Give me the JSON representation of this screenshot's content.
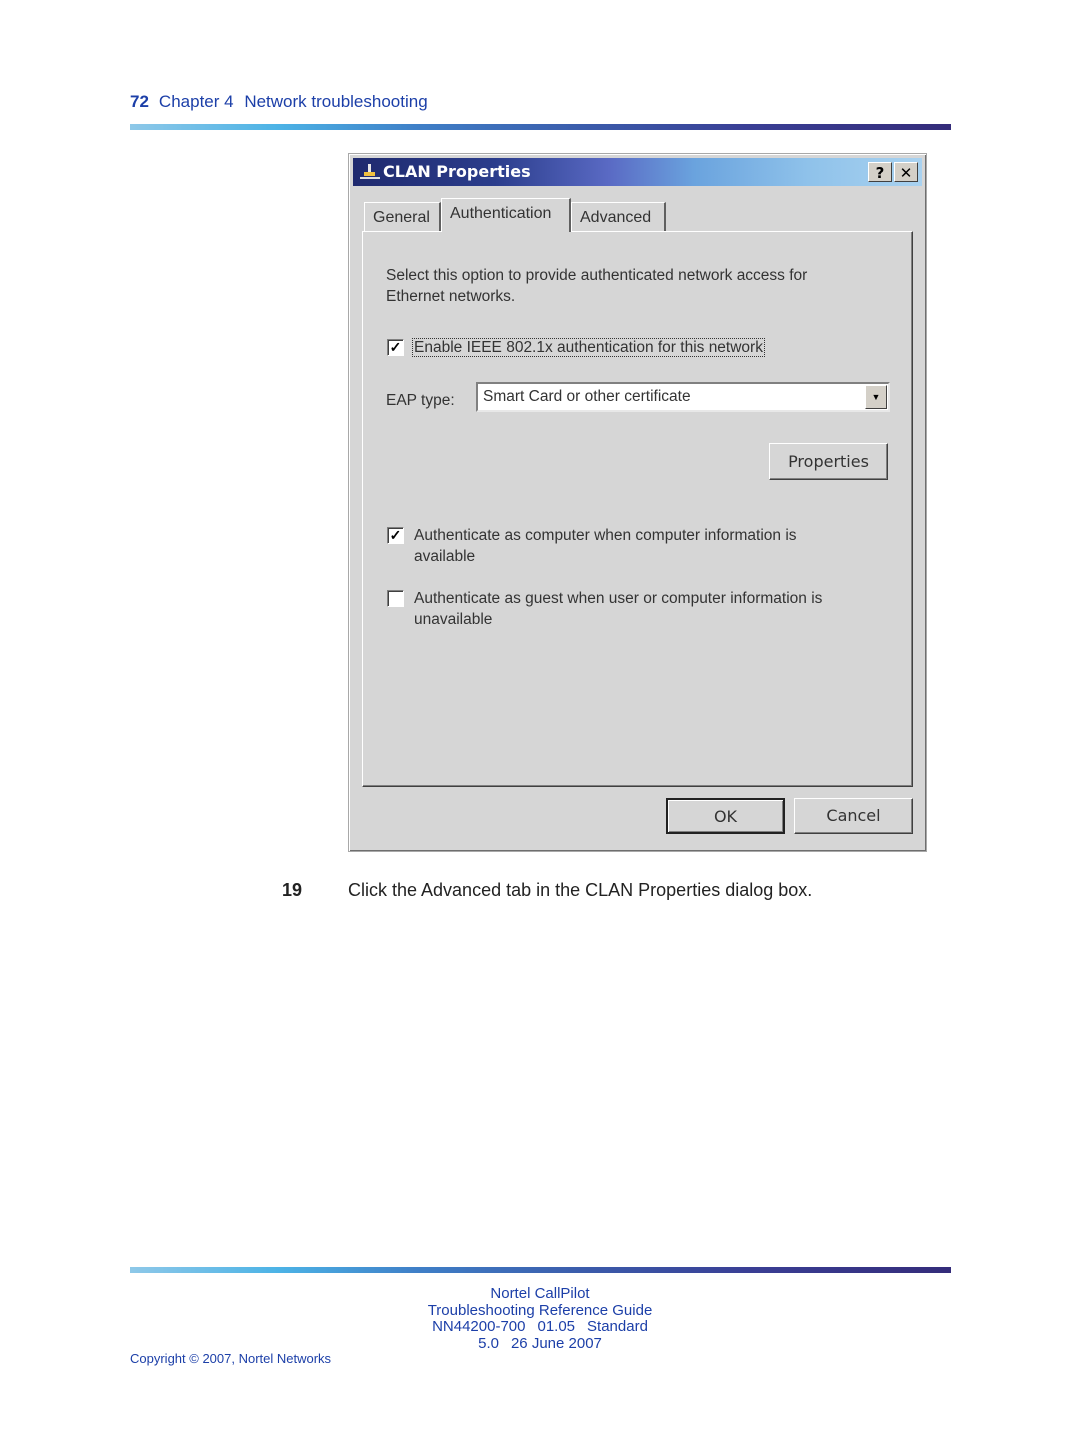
{
  "header": {
    "page_number": "72",
    "chapter": "Chapter 4",
    "section": "Network troubleshooting"
  },
  "dialog": {
    "title": "CLAN Properties",
    "title_icon": "network-connection-icon",
    "help_button": "?",
    "close_button": "✕",
    "tabs": [
      {
        "label": "General",
        "active": false
      },
      {
        "label": "Authentication",
        "active": true
      },
      {
        "label": "Advanced",
        "active": false
      }
    ],
    "description": "Select this option to provide authenticated network access for Ethernet networks.",
    "enable_8021x": {
      "label": "Enable IEEE 802.1x authentication for this network",
      "checked": true
    },
    "eap_type": {
      "label": "EAP type:",
      "value": "Smart Card or other certificate"
    },
    "properties_button": "Properties",
    "auth_computer": {
      "label": "Authenticate as computer when computer information is available",
      "checked": true
    },
    "auth_guest": {
      "label": "Authenticate as guest when user or computer information is unavailable",
      "checked": false
    },
    "ok_button": "OK",
    "cancel_button": "Cancel"
  },
  "step": {
    "number": "19",
    "text": "Click the Advanced tab in the CLAN Properties dialog box."
  },
  "footer": {
    "product": "Nortel CallPilot",
    "guide": "Troubleshooting Reference Guide",
    "doc_number": "NN44200-700",
    "doc_version": "01.05",
    "doc_status": "Standard",
    "release": "5.0",
    "date": "26 June 2007",
    "copyright": "Copyright © 2007, Nortel Networks"
  },
  "colors": {
    "accent_blue": "#1c3fa8",
    "titlebar_dark": "#1f2a6e",
    "dialog_bg": "#d6d6d6"
  }
}
